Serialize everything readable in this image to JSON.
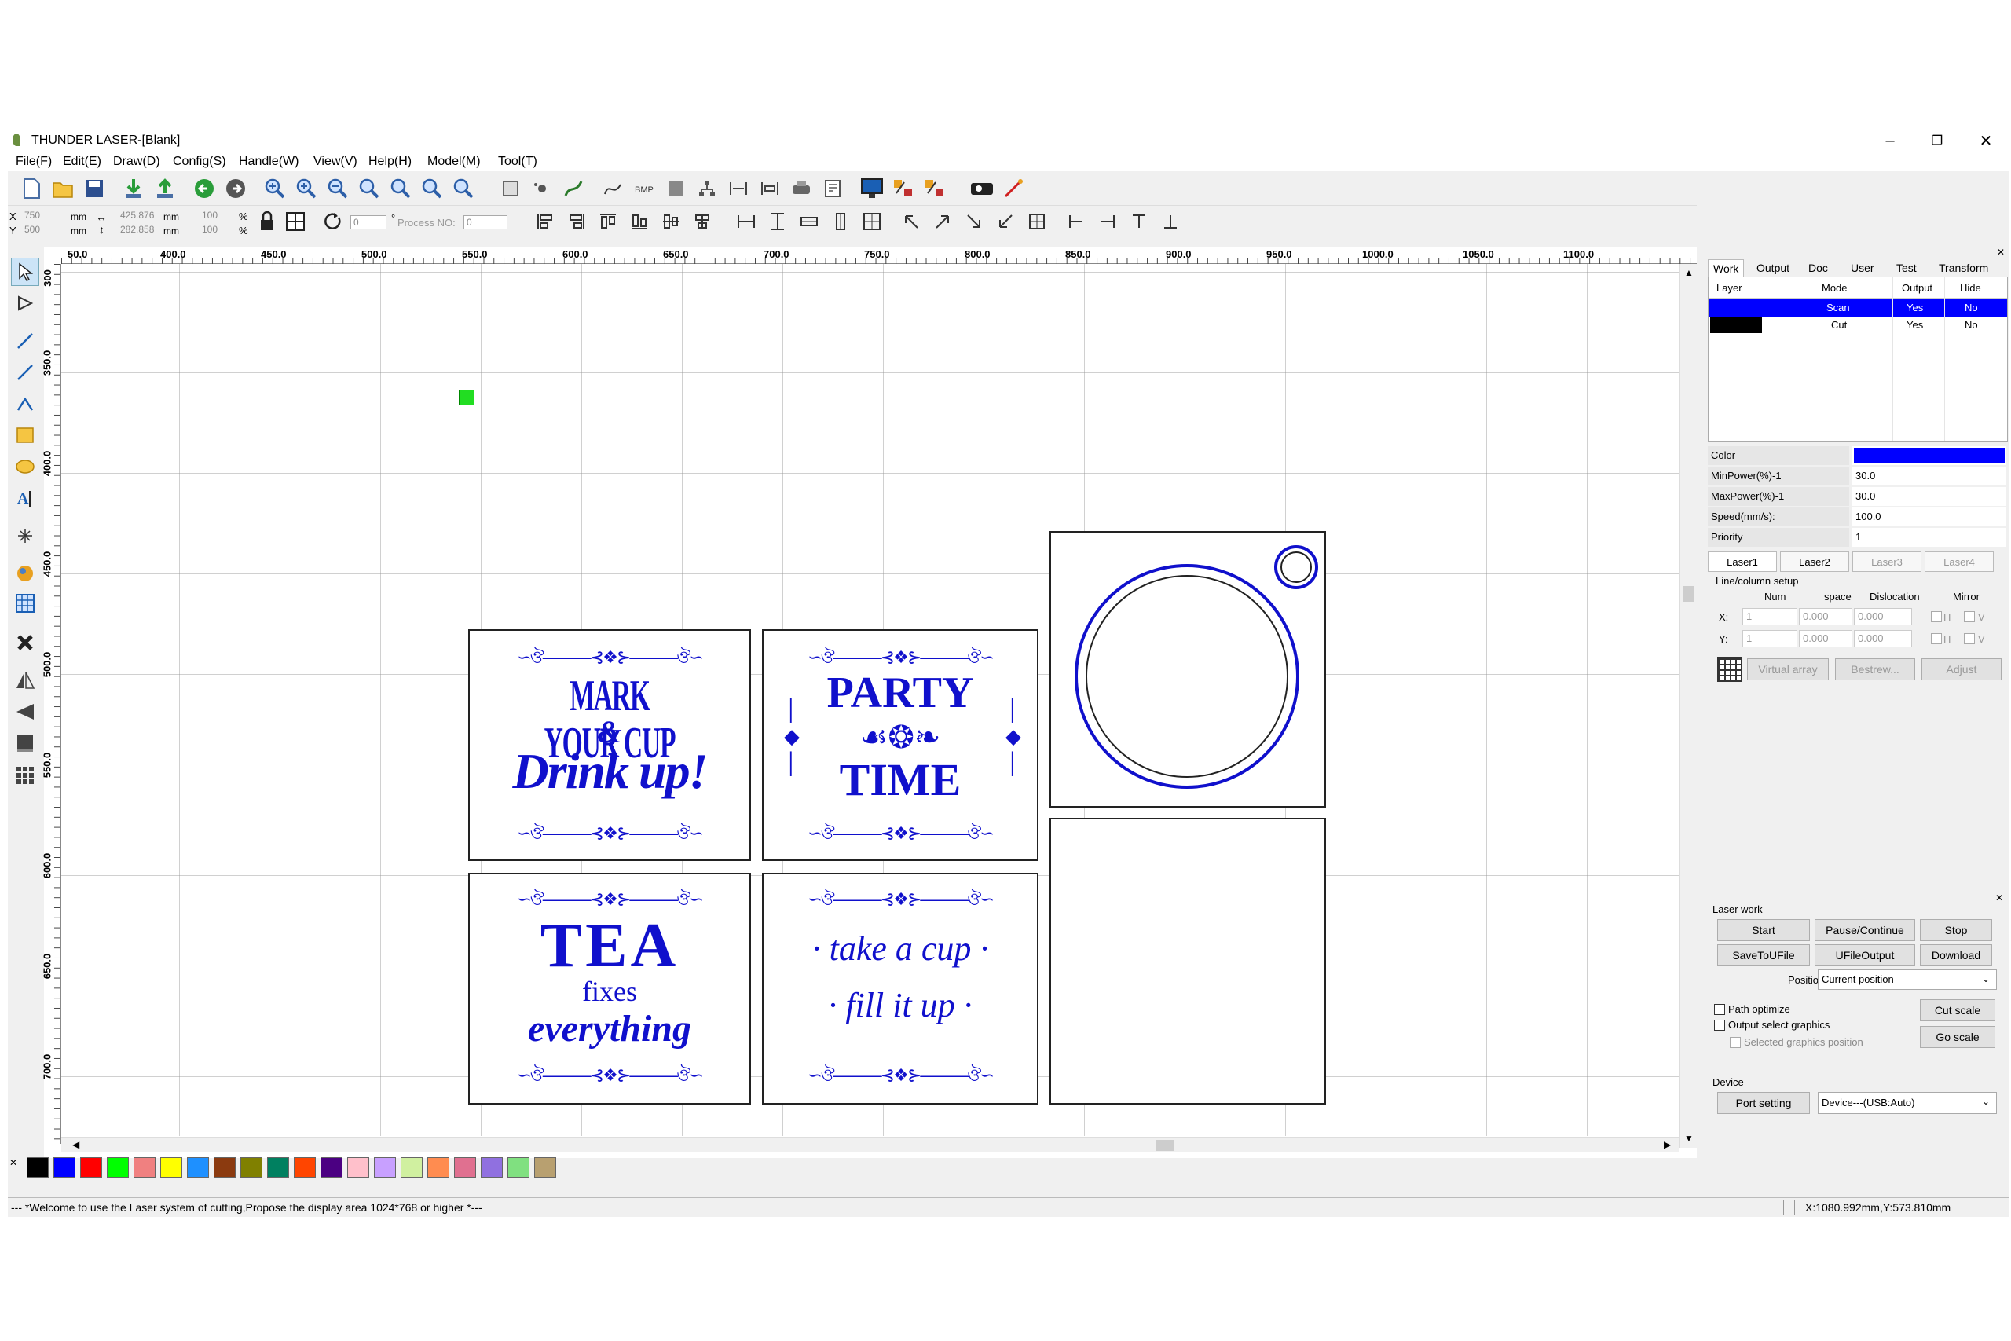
{
  "window": {
    "title": "THUNDER LASER-[Blank]",
    "minimize": "–",
    "maximize": "❐",
    "close": "✕"
  },
  "menu": [
    "File(F)",
    "Edit(E)",
    "Draw(D)",
    "Config(S)",
    "Handle(W)",
    "View(V)",
    "Help(H)",
    "Model(M)",
    "Tool(T)"
  ],
  "toolbar2": {
    "x_label": "X",
    "y_label": "Y",
    "x_value": "750",
    "y_value": "500",
    "unit1": "mm",
    "unit2": "mm",
    "w_value": "425.876",
    "h_value": "282.858",
    "unit3": "mm",
    "unit4": "mm",
    "pct1": "100",
    "pct2": "100",
    "pct_sign1": "%",
    "pct_sign2": "%",
    "rotate_value": "0",
    "deg": "°",
    "process_label": "Process NO:",
    "process_value": "0"
  },
  "ruler": {
    "h": [
      "50.0",
      "400.0",
      "450.0",
      "500.0",
      "550.0",
      "600.0",
      "650.0",
      "700.0",
      "750.0",
      "800.0",
      "850.0",
      "900.0",
      "950.0",
      "1000.0",
      "1050.0",
      "1100.0"
    ],
    "v": [
      "300",
      "350.0",
      "400.0",
      "450.0",
      "500.0",
      "550.0",
      "600.0",
      "650.0",
      "700.0"
    ]
  },
  "designs": {
    "card1": {
      "line1": "MARK YOUR CUP",
      "line2": "&",
      "line3": "Drink up!"
    },
    "card2": {
      "line1": "PARTY",
      "line2": "TIME"
    },
    "card3": {
      "line1": "TEA",
      "line2": "fixes",
      "line3": "everything"
    },
    "card4": {
      "line1": "· take a cup ·",
      "line2": "· fill it up ·"
    }
  },
  "palette": [
    "#000000",
    "#0000ff",
    "#ff0000",
    "#00ff00",
    "#f08080",
    "#ffff00",
    "#1e90ff",
    "#8b3a0f",
    "#808000",
    "#008060",
    "#ff4500",
    "#4b0082",
    "#ffc0cb",
    "#c8a0ff",
    "#d0f0a0",
    "#ff8c50",
    "#e07090",
    "#9070e0",
    "#80e080",
    "#b8a070"
  ],
  "panel": {
    "tabs": [
      "Work",
      "Output",
      "Doc",
      "User",
      "Test",
      "Transform"
    ],
    "close_glyph": "✕",
    "layer_table": {
      "headers": [
        "Layer",
        "Mode",
        "Output",
        "Hide"
      ],
      "rows": [
        {
          "color": "#0000ff",
          "mode": "Scan",
          "output": "Yes",
          "hide": "No"
        },
        {
          "color": "#000000",
          "mode": "Cut",
          "output": "Yes",
          "hide": "No"
        }
      ]
    },
    "props": {
      "color_label": "Color",
      "color_value": "#0000ff",
      "minpower_label": "MinPower(%)-1",
      "minpower_value": "30.0",
      "maxpower_label": "MaxPower(%)-1",
      "maxpower_value": "30.0",
      "speed_label": "Speed(mm/s):",
      "speed_value": "100.0",
      "priority_label": "Priority",
      "priority_value": "1"
    },
    "laser_tabs": [
      "Laser1",
      "Laser2",
      "Laser3",
      "Laser4"
    ],
    "linecol": {
      "title": "Line/column setup",
      "h_num": "Num",
      "h_space": "space",
      "h_disloc": "Dislocation",
      "h_mirror": "Mirror",
      "x_label": "X:",
      "y_label": "Y:",
      "x_num": "1",
      "x_space": "0.000",
      "x_disloc": "0.000",
      "y_num": "1",
      "y_space": "0.000",
      "y_disloc": "0.000",
      "h": "H",
      "v": "V",
      "virtual_array": "Virtual array",
      "bestrew": "Bestrew...",
      "adjust": "Adjust"
    },
    "laserwork": {
      "title": "Laser work",
      "start": "Start",
      "pause": "Pause/Continue",
      "stop": "Stop",
      "save_file": "SaveToUFile",
      "ufile_output": "UFileOutput",
      "download": "Download",
      "position_label": "Position:",
      "position_value": "Current position",
      "path_optimize": "Path optimize",
      "output_select": "Output select graphics",
      "selected_pos": "Selected graphics position",
      "cut_scale": "Cut scale",
      "go_scale": "Go scale"
    },
    "device": {
      "title": "Device",
      "port_setting": "Port setting",
      "device_value": "Device---(USB:Auto)"
    }
  },
  "status": {
    "message": "--- *Welcome to use the Laser system of cutting,Propose the display area 1024*768 or higher *---",
    "coords": "X:1080.992mm,Y:573.810mm"
  }
}
